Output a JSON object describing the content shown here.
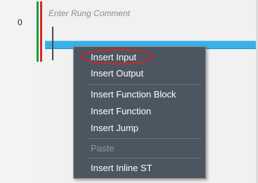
{
  "rung": {
    "number": "0",
    "comment_placeholder": "Enter Rung Comment"
  },
  "context_menu": {
    "items": [
      {
        "label": "Insert Input",
        "enabled": true,
        "circled": true
      },
      {
        "label": "Insert Output",
        "enabled": true
      },
      {
        "label": "Insert Function Block",
        "enabled": true
      },
      {
        "label": "Insert Function",
        "enabled": true
      },
      {
        "label": "Insert Jump",
        "enabled": true
      },
      {
        "label": "Paste",
        "enabled": false
      },
      {
        "label": "Insert Inline ST",
        "enabled": true
      }
    ]
  },
  "colors": {
    "menu_background": "#4b5661",
    "rung_line": "#3ab1e6",
    "left_rail_green": "#1e9e3c",
    "left_rail_red": "#d32a2a",
    "callout_circle": "#e02020"
  }
}
